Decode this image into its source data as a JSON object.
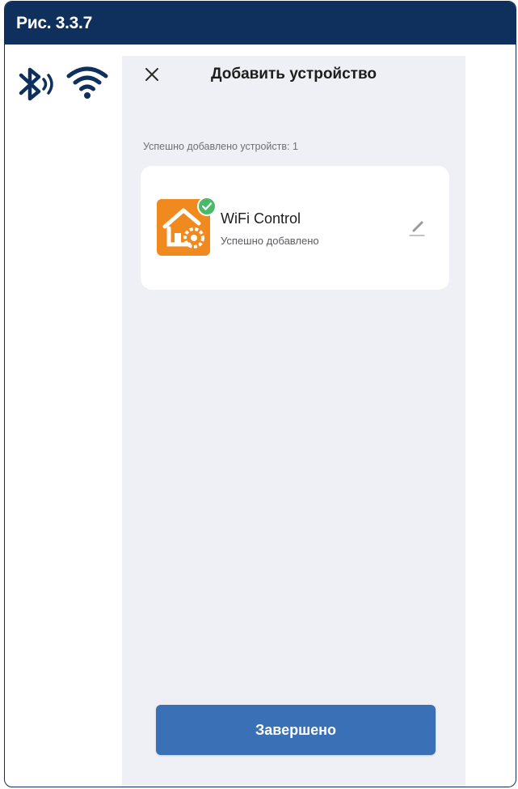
{
  "figure": {
    "title": "Рис. 3.3.7"
  },
  "connectivity": {
    "bluetooth_icon": "bluetooth-icon",
    "wifi_icon": "wifi-icon"
  },
  "screen": {
    "title": "Добавить устройство",
    "close_icon": "close-icon",
    "added_count_text": "Успешно добавлено устройств: 1",
    "devices": [
      {
        "name": "WiFi Control",
        "status": "Успешно добавлено",
        "icon": "smart-home-gear-icon",
        "badge_icon": "check-circle-icon",
        "edit_icon": "edit-icon"
      }
    ],
    "done_button": "Завершено"
  },
  "colors": {
    "header_bg": "#0f2f5c",
    "screen_bg": "#eff0f5",
    "accent_button": "#3a70b6",
    "device_icon_bg": "#f08a1e",
    "success_badge": "#4cb96a"
  }
}
